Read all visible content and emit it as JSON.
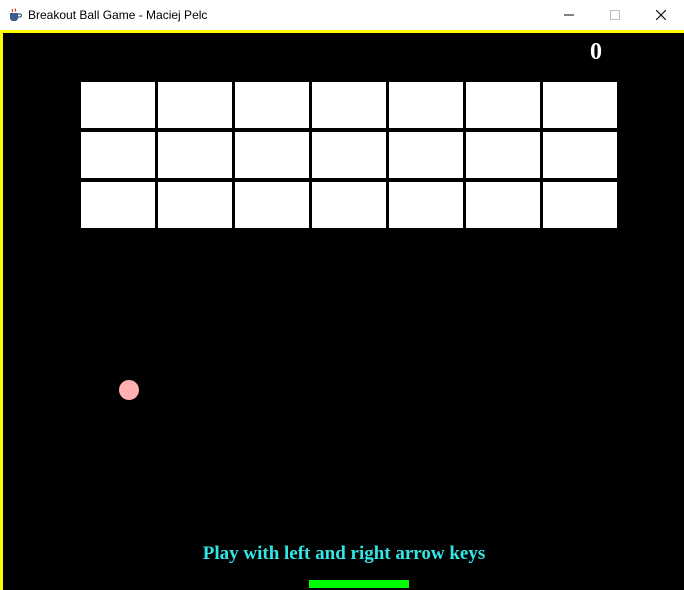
{
  "window": {
    "title": "Breakout Ball Game - Maciej Pelc",
    "app_icon": "java-cup-icon",
    "controls": {
      "minimize_icon": "minimize-icon",
      "maximize_icon": "maximize-icon",
      "close_icon": "close-icon"
    }
  },
  "game": {
    "score": "0",
    "message": "Play with left and right arrow keys",
    "bricks": {
      "rows": 3,
      "columns": 7,
      "remaining": 21
    },
    "colors": {
      "background": "#000000",
      "border": "#ffff00",
      "brick": "#ffffff",
      "ball": "#ffb0b0",
      "paddle": "#00ff00",
      "message": "#33e6e6",
      "score": "#ffffff"
    }
  }
}
